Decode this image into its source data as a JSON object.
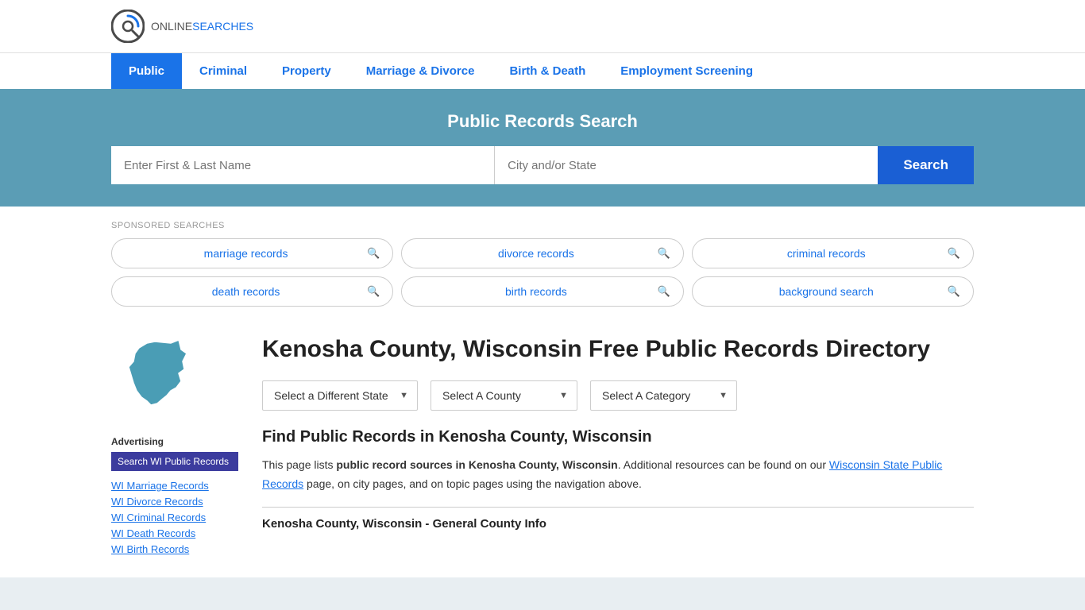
{
  "logo": {
    "online": "ONLINE",
    "searches": "SEARCHES"
  },
  "nav": {
    "items": [
      {
        "label": "Public",
        "active": true
      },
      {
        "label": "Criminal",
        "active": false
      },
      {
        "label": "Property",
        "active": false
      },
      {
        "label": "Marriage & Divorce",
        "active": false
      },
      {
        "label": "Birth & Death",
        "active": false
      },
      {
        "label": "Employment Screening",
        "active": false
      }
    ]
  },
  "search_banner": {
    "title": "Public Records Search",
    "name_placeholder": "Enter First & Last Name",
    "location_placeholder": "City and/or State",
    "button_label": "Search"
  },
  "sponsored": {
    "label": "SPONSORED SEARCHES",
    "items": [
      "marriage records",
      "divorce records",
      "criminal records",
      "death records",
      "birth records",
      "background search"
    ]
  },
  "page": {
    "title": "Kenosha County, Wisconsin Free Public Records Directory",
    "selectors": {
      "state": "Select a Different State",
      "county": "Select A County",
      "category": "Select A Category"
    },
    "find_title": "Find Public Records in Kenosha County, Wisconsin",
    "description_1": "This page lists ",
    "description_bold": "public record sources in Kenosha County, Wisconsin",
    "description_2": ". Additional resources can be found on our ",
    "description_link": "Wisconsin State Public Records",
    "description_3": " page, on city pages, and on topic pages using the navigation above.",
    "section_subtitle": "Kenosha County, Wisconsin - General County Info"
  },
  "sidebar": {
    "advertising_label": "Advertising",
    "ad_button": "Search WI Public Records",
    "links": [
      "WI Marriage Records",
      "WI Divorce Records",
      "WI Criminal Records",
      "WI Death Records",
      "WI Birth Records"
    ]
  }
}
